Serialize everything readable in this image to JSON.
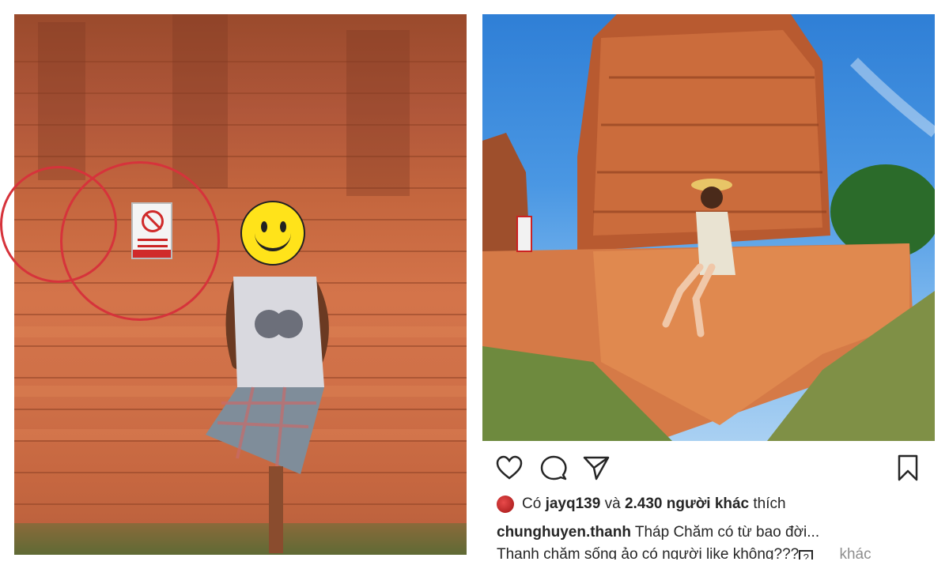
{
  "post": {
    "likes": {
      "prefix": "Có",
      "user": "jayq139",
      "connector": "và",
      "count_text": "2.430 người khác",
      "suffix": "thích"
    },
    "caption": {
      "username": "chunghuyen.thanh",
      "line1": "Tháp Chăm có từ bao đời...",
      "line2": "Thanh chăm sống ảo có người like không???",
      "unknown_glyph": "?",
      "more": "khác"
    }
  },
  "icons": {
    "like": "heart-icon",
    "comment": "comment-bubble-icon",
    "share": "paper-plane-icon",
    "save": "bookmark-icon",
    "emoji_cover": "smiley-face-icon",
    "no_climbing_sign": "prohibition-sign-icon"
  },
  "colors": {
    "highlight_circle": "#d6333b",
    "brick": "#c4663e",
    "sky": "#4a97e3",
    "text": "#262626",
    "muted": "#8e8e8e"
  }
}
